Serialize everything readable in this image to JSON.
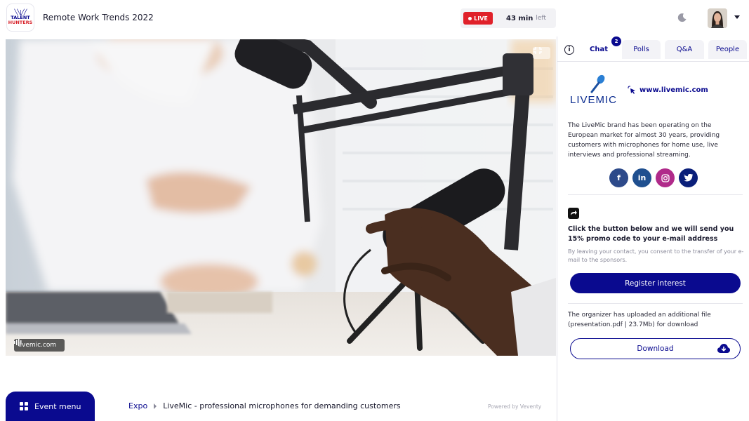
{
  "header": {
    "logo_line1": "TALENT",
    "logo_line2": "HUNTERS",
    "event_title": "Remote Work Trends 2022",
    "live_label": "LIVE",
    "time_left_value": "43 min",
    "time_left_suffix": "left",
    "theme_toggle_icon": "moon-icon",
    "user_menu_icon": "chevron-down-icon"
  },
  "stream": {
    "watermark": "livemic.com",
    "collapse_icon": "collapse-icon"
  },
  "panel": {
    "tabs": [
      {
        "label": "Chat",
        "active": true,
        "badge": "2"
      },
      {
        "label": "Polls",
        "active": false
      },
      {
        "label": "Q&A",
        "active": false
      },
      {
        "label": "People",
        "active": false
      }
    ],
    "sponsor": {
      "name": "LIVEMIC",
      "website": "www.livemic.com",
      "description": "The LiveMic brand has been operating on the European market for almost 30 years, providing customers with microphones for home use, live interviews and professional streaming.",
      "socials": [
        {
          "icon": "facebook-icon",
          "glyph": "f",
          "color": "#2d4a8a"
        },
        {
          "icon": "linkedin-icon",
          "glyph": "in",
          "color": "#1f4f8f"
        },
        {
          "icon": "instagram-icon",
          "glyph": "◎",
          "color": "#b02a8a"
        },
        {
          "icon": "twitter-icon",
          "glyph": "✦",
          "color": "#0a1f7a"
        }
      ]
    },
    "promo": {
      "title": "Click the button below and we will send you 15% promo code to your e-mail address",
      "consent": "By leaving your contact, you consent to the transfer of your e-mail to the sponsors.",
      "button_label": "Register interest"
    },
    "file": {
      "note": "The organizer has uploaded an additional file (presentation.pdf | 23.7Mb) for download",
      "button_label": "Download"
    }
  },
  "footer": {
    "event_menu_label": "Event menu",
    "breadcrumb_parent": "Expo",
    "breadcrumb_current": "LiveMic - professional microphones for demanding customers",
    "powered_by": "Powered by Veventy"
  },
  "colors": {
    "brand": "#0a0a8f",
    "live": "#e0212a"
  }
}
